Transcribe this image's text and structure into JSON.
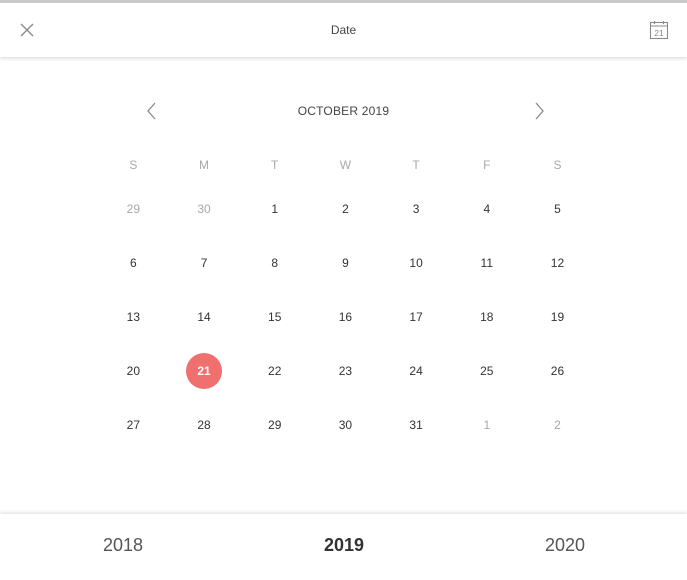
{
  "header": {
    "title": "Date",
    "close_icon": "close-icon",
    "calendar_icon": "calendar-icon",
    "calendar_icon_day": "21"
  },
  "month_nav": {
    "label": "OCTOBER 2019",
    "prev_icon": "chevron-left-icon",
    "next_icon": "chevron-right-icon"
  },
  "weekdays": [
    "S",
    "M",
    "T",
    "W",
    "T",
    "F",
    "S"
  ],
  "weeks": [
    [
      {
        "d": "29",
        "muted": true
      },
      {
        "d": "30",
        "muted": true
      },
      {
        "d": "1"
      },
      {
        "d": "2"
      },
      {
        "d": "3"
      },
      {
        "d": "4"
      },
      {
        "d": "5"
      }
    ],
    [
      {
        "d": "6"
      },
      {
        "d": "7"
      },
      {
        "d": "8"
      },
      {
        "d": "9"
      },
      {
        "d": "10"
      },
      {
        "d": "11"
      },
      {
        "d": "12"
      }
    ],
    [
      {
        "d": "13"
      },
      {
        "d": "14"
      },
      {
        "d": "15"
      },
      {
        "d": "16"
      },
      {
        "d": "17"
      },
      {
        "d": "18"
      },
      {
        "d": "19"
      }
    ],
    [
      {
        "d": "20"
      },
      {
        "d": "21",
        "selected": true
      },
      {
        "d": "22"
      },
      {
        "d": "23"
      },
      {
        "d": "24"
      },
      {
        "d": "25"
      },
      {
        "d": "26"
      }
    ],
    [
      {
        "d": "27"
      },
      {
        "d": "28"
      },
      {
        "d": "29"
      },
      {
        "d": "30"
      },
      {
        "d": "31"
      },
      {
        "d": "1",
        "muted": true
      },
      {
        "d": "2",
        "muted": true
      }
    ]
  ],
  "selected_color": "#f07070",
  "years": {
    "prev": "2018",
    "current": "2019",
    "next": "2020"
  }
}
